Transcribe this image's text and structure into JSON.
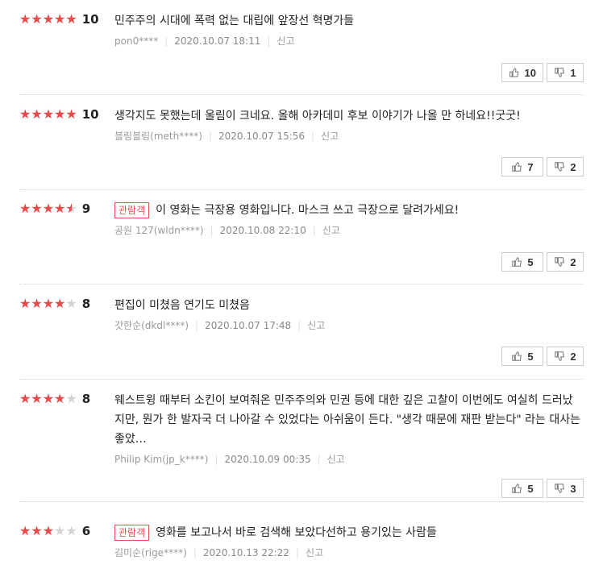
{
  "reviews": [
    {
      "rating": 10,
      "score_label": "10",
      "badge": "",
      "text": "민주주의 시대에 폭력 없는 대립에 앞장선 혁명가들",
      "author": "pon0****",
      "date": "2020.10.07 18:11",
      "report": "신고",
      "up": "10",
      "down": "1"
    },
    {
      "rating": 10,
      "score_label": "10",
      "badge": "",
      "text": "생각지도 못했는데 울림이 크네요. 올해 아카데미 후보 이야기가 나올 만 하네요!!굿굿!",
      "author": "블링블링(meth****)",
      "date": "2020.10.07 15:56",
      "report": "신고",
      "up": "7",
      "down": "2"
    },
    {
      "rating": 9,
      "score_label": "9",
      "badge": "관람객",
      "text": "이 영화는 극장용 영화입니다. 마스크 쓰고 극장으로 달려가세요!",
      "author": "공원 127(wldn****)",
      "date": "2020.10.08 22:10",
      "report": "신고",
      "up": "5",
      "down": "2"
    },
    {
      "rating": 8,
      "score_label": "8",
      "badge": "",
      "text": "편집이 미쳤음 연기도 미쳤음",
      "author": "갓한순(dkdl****)",
      "date": "2020.10.07 17:48",
      "report": "신고",
      "up": "5",
      "down": "2"
    },
    {
      "rating": 8,
      "score_label": "8",
      "badge": "",
      "text": "웨스트윙 때부터 소킨이 보여줘온 민주주의와 민권 등에 대한 깊은 고찰이 이번에도 여실히 드러났지만, 뭔가 한 발자국 더 나아갈 수 있었다는 아쉬움이 든다. \"생각 때문에 재판 받는다\" 라는 대사는 좋았…",
      "author": "Philip Kim(jp_k****)",
      "date": "2020.10.09 00:35",
      "report": "신고",
      "up": "5",
      "down": "3"
    },
    {
      "rating": 6,
      "score_label": "6",
      "badge": "관람객",
      "text": "영화를 보고나서 바로 검색해 보았다선하고 용기있는 사람들",
      "author": "김미순(rige****)",
      "date": "2020.10.13 22:22",
      "report": "신고",
      "up": "",
      "down": ""
    }
  ],
  "colors": {
    "star_on": "#e84a4a",
    "star_off": "#d3d3d3",
    "badge": "#e34f4f"
  },
  "icons": {
    "up": "thumb-up-icon",
    "down": "thumb-down-icon",
    "star": "star-icon"
  }
}
